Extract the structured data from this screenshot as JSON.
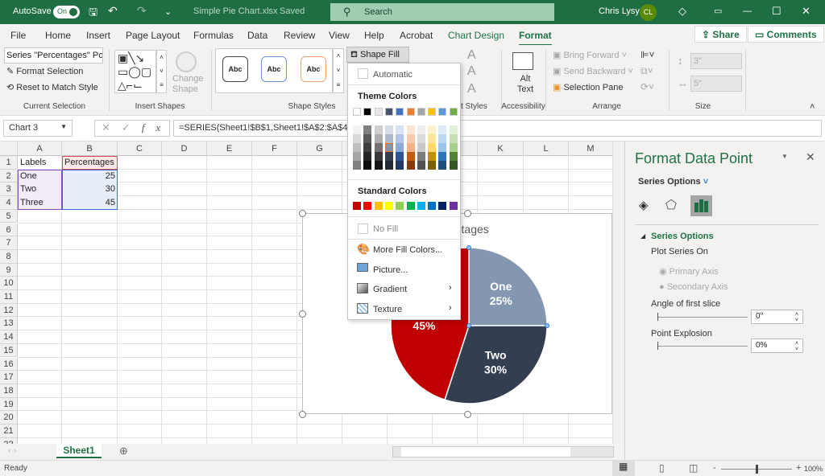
{
  "titlebar": {
    "autosave_label": "AutoSave",
    "autosave_state": "On",
    "filename": "Simple Pie Chart.xlsx",
    "save_state": "Saved",
    "search_placeholder": "Search",
    "user_name": "Chris Lysy",
    "user_initials": "CL",
    "accent": "#1f6e43"
  },
  "tabs": [
    {
      "label": "File"
    },
    {
      "label": "Home"
    },
    {
      "label": "Insert"
    },
    {
      "label": "Page Layout"
    },
    {
      "label": "Formulas"
    },
    {
      "label": "Data"
    },
    {
      "label": "Review"
    },
    {
      "label": "View"
    },
    {
      "label": "Help"
    },
    {
      "label": "Acrobat"
    },
    {
      "label": "Chart Design"
    },
    {
      "label": "Format"
    }
  ],
  "share_label": "Share",
  "comments_label": "Comments",
  "ribbon": {
    "current_selection": {
      "selector_value": "Series \"Percentages\" Po",
      "format_selection": "Format Selection",
      "reset_style": "Reset to Match Style",
      "label": "Current Selection"
    },
    "insert_shapes": {
      "change_shape": "Change Shape",
      "label": "Insert Shapes"
    },
    "shape_styles": {
      "styles": [
        "Abc",
        "Abc",
        "Abc"
      ],
      "shape_fill": "Shape Fill",
      "label": "Shape Styles"
    },
    "wordart_label": "t Styles",
    "accessibility": {
      "alt_text": "Alt Text",
      "label": "Accessibility"
    },
    "arrange": {
      "bring_forward": "Bring Forward",
      "send_backward": "Send Backward",
      "selection_pane": "Selection Pane",
      "label": "Arrange"
    },
    "size": {
      "height": "3\"",
      "width": "5\"",
      "label": "Size"
    }
  },
  "formula_bar": {
    "name_box": "Chart 3",
    "formula": "=SERIES(Sheet1!$B$1,Sheet1!$A$2:$A$4,"
  },
  "sheet": {
    "columns": [
      "A",
      "B",
      "C",
      "D",
      "E",
      "F",
      "G",
      "H",
      "I",
      "J",
      "K",
      "L",
      "M"
    ],
    "rows": [
      "1",
      "2",
      "3",
      "4",
      "5",
      "6",
      "7",
      "8",
      "9",
      "10",
      "11",
      "12",
      "13",
      "14",
      "15",
      "16",
      "17",
      "18",
      "19",
      "20",
      "21",
      "22"
    ],
    "cells": [
      [
        "Labels",
        "Percentages"
      ],
      [
        "One",
        "25"
      ],
      [
        "Two",
        "30"
      ],
      [
        "Three",
        "45"
      ]
    ]
  },
  "sheet_tabs": [
    {
      "label": "Sheet1"
    }
  ],
  "status": {
    "text": "Ready",
    "zoom": "100%"
  },
  "shape_fill_menu": {
    "automatic": "Automatic",
    "theme_colors_label": "Theme Colors",
    "theme_colors": [
      "#ffffff",
      "#000000",
      "#e7e6e6",
      "#44546a",
      "#4472c4",
      "#ed7d31",
      "#a5a5a5",
      "#ffc000",
      "#5b9bd5",
      "#70ad47"
    ],
    "theme_shades": [
      [
        "#f2f2f2",
        "#d9d9d9",
        "#bfbfbf",
        "#a6a6a6",
        "#808080"
      ],
      [
        "#808080",
        "#595959",
        "#404040",
        "#262626",
        "#0d0d0d"
      ],
      [
        "#d0cece",
        "#aeabab",
        "#757171",
        "#3a3838",
        "#171616"
      ],
      [
        "#d6dce4",
        "#adb9ca",
        "#8497b0",
        "#333f50",
        "#222a35"
      ],
      [
        "#d9e2f3",
        "#b4c6e7",
        "#8eaadb",
        "#2f5496",
        "#1f3864"
      ],
      [
        "#fbe5d5",
        "#f7cbac",
        "#f4b183",
        "#c55a11",
        "#843c0b"
      ],
      [
        "#ededed",
        "#dbdbdb",
        "#c9c9c9",
        "#7b7b7b",
        "#525252"
      ],
      [
        "#fff2cc",
        "#fee599",
        "#ffd965",
        "#bf9000",
        "#7f6000"
      ],
      [
        "#deebf6",
        "#bdd7ee",
        "#9dc3e6",
        "#2e75b5",
        "#1f4e79"
      ],
      [
        "#e2efd9",
        "#c5e0b3",
        "#a8d08d",
        "#538135",
        "#375623"
      ]
    ],
    "selected_color": "#8497b0",
    "standard_colors_label": "Standard Colors",
    "standard_colors": [
      "#c00000",
      "#ff0000",
      "#ffc000",
      "#ffff00",
      "#92d050",
      "#00b050",
      "#00b0f0",
      "#0070c0",
      "#002060",
      "#7030a0"
    ],
    "no_fill": "No Fill",
    "more_fill_colors": "More Fill Colors...",
    "picture": "Picture...",
    "gradient": "Gradient",
    "texture": "Texture"
  },
  "pane": {
    "title": "Format Data Point",
    "options_dropdown": "Series Options",
    "section": "Series Options",
    "plot_series_on": "Plot Series On",
    "primary_axis": "Primary Axis",
    "secondary_axis": "Secondary Axis",
    "angle_label": "Angle of first slice",
    "angle_value": "0°",
    "angle": 0,
    "explosion_label": "Point Explosion",
    "explosion_value": "0%",
    "explosion": 0
  },
  "chart_data": {
    "type": "pie",
    "title": "Percentages",
    "categories": [
      "One",
      "Two",
      "Three"
    ],
    "values": [
      25,
      30,
      45
    ],
    "value_labels": [
      "25%",
      "30%",
      "45%"
    ],
    "colors": [
      "#8497b0",
      "#333f50",
      "#c00000"
    ],
    "start_angle": 0
  }
}
